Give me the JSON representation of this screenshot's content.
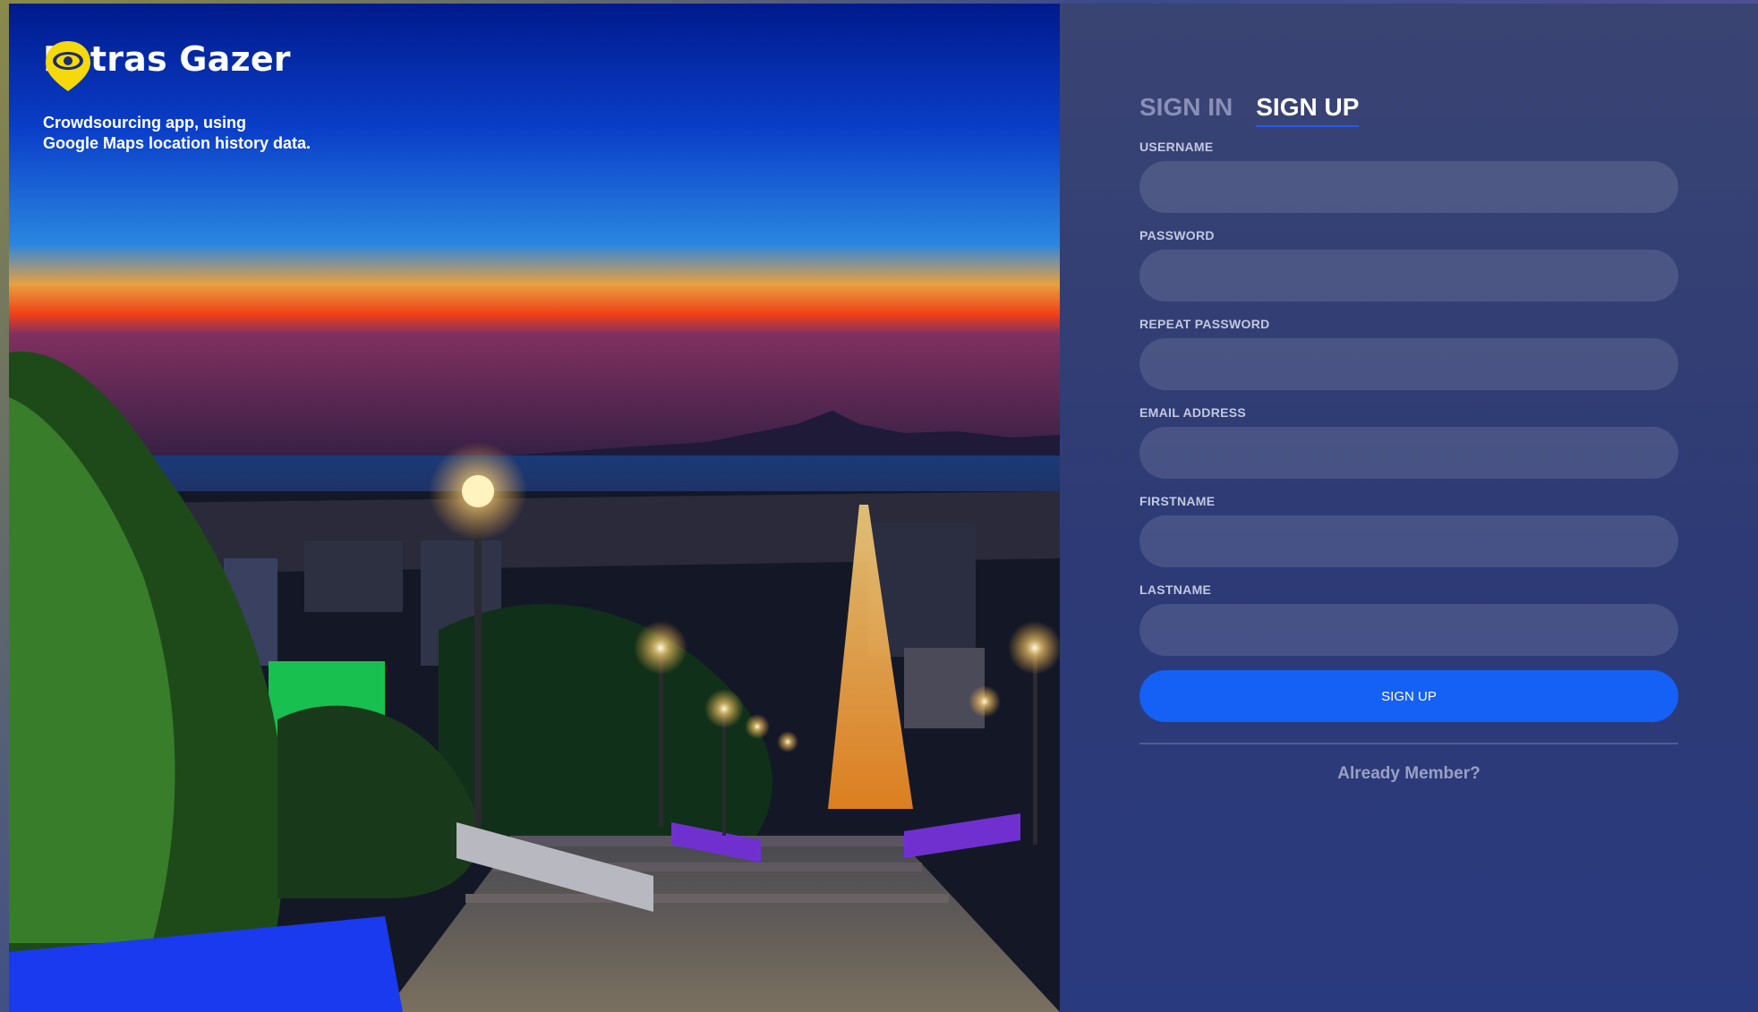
{
  "brand": {
    "name": "Patras Gazer",
    "tagline_line1": "Crowdsourcing app, using",
    "tagline_line2": "Google Maps location history data.",
    "logo_icon": "map-pin-eye-icon",
    "logo_color": "#f5d90a"
  },
  "tabs": {
    "sign_in": "SIGN IN",
    "sign_up": "SIGN UP",
    "active": "sign_up"
  },
  "form": {
    "fields": [
      {
        "label": "USERNAME",
        "value": "",
        "type": "text"
      },
      {
        "label": "PASSWORD",
        "value": "",
        "type": "password"
      },
      {
        "label": "REPEAT PASSWORD",
        "value": "",
        "type": "password"
      },
      {
        "label": "EMAIL ADDRESS",
        "value": "",
        "type": "text"
      },
      {
        "label": "FIRSTNAME",
        "value": "",
        "type": "text"
      },
      {
        "label": "LASTNAME",
        "value": "",
        "type": "text"
      }
    ],
    "submit_label": "SIGN UP",
    "already_member": "Already Member?"
  },
  "colors": {
    "accent": "#1560f5",
    "panel": "#2d3a75",
    "tab_inactive": "#8890b6"
  },
  "background_photo": {
    "subject": "night-city-stairs-sunset"
  }
}
